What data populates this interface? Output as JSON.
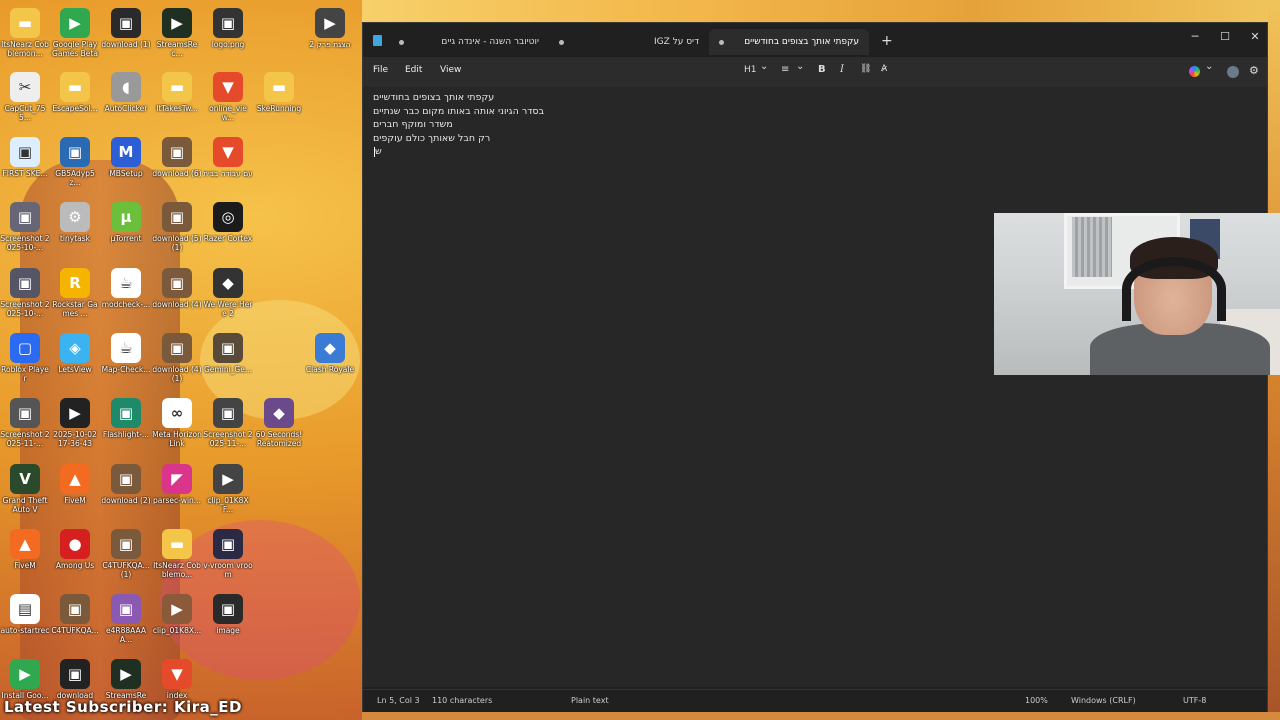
{
  "desktop": {
    "icons": [
      {
        "label": "ItsNearz Cobblemon...",
        "icon": "folder-icon",
        "color": "#f3c64a"
      },
      {
        "label": "Google Play Games Beta",
        "icon": "google-play-games-icon",
        "color": "#2fa84f"
      },
      {
        "label": "download (1)",
        "icon": "image-file-icon",
        "color": "#2a2a2a"
      },
      {
        "label": "StreamsRec...",
        "icon": "video-file-icon",
        "color": "#1f2f22"
      },
      {
        "label": "logo.png",
        "icon": "image-file-icon",
        "color": "#333"
      },
      {
        "label": "הצגת פרק 2",
        "icon": "video-file-icon",
        "color": "#444"
      },
      {
        "label": "CapCut_755...",
        "icon": "capcut-icon",
        "color": "#eeeeee"
      },
      {
        "label": "EscapeSol...",
        "icon": "folder-icon",
        "color": "#f3c64a"
      },
      {
        "label": "AutoClicker",
        "icon": "mouse-icon",
        "color": "#999"
      },
      {
        "label": "ItTakesTw...",
        "icon": "folder-icon",
        "color": "#f3c64a"
      },
      {
        "label": "online_view...",
        "icon": "brave-icon",
        "color": "#e54b2a"
      },
      {
        "label": "SkeRunning",
        "icon": "folder-icon",
        "color": "#f3c64a"
      },
      {
        "label": "FIRST SKE...",
        "icon": "image-file-icon",
        "color": "#ddeeff"
      },
      {
        "label": "GB5Adyp5z...",
        "icon": "image-file-icon",
        "color": "#2a6ab3"
      },
      {
        "label": "MBSetup",
        "icon": "malwarebytes-icon",
        "color": "#2c5fd6"
      },
      {
        "label": "download (6)",
        "icon": "image-file-icon",
        "color": "#7b5a3c"
      },
      {
        "label": "עם עבודה בבית",
        "icon": "brave-icon",
        "color": "#e54b2a"
      },
      {
        "label": "Screenshot 2025-10-...",
        "icon": "image-file-icon",
        "color": "#667"
      },
      {
        "label": "tinytask",
        "icon": "gear-icon",
        "color": "#bbb"
      },
      {
        "label": "μTorrent",
        "icon": "utorrent-icon",
        "color": "#6cbf3a"
      },
      {
        "label": "download (5) (1)",
        "icon": "image-file-icon",
        "color": "#7b5a3c"
      },
      {
        "label": "Razer Cortex",
        "icon": "razer-icon",
        "color": "#1b1b1b"
      },
      {
        "label": "Screenshot 2025-10-...",
        "icon": "image-file-icon",
        "color": "#556"
      },
      {
        "label": "Rockstar Games ...",
        "icon": "rockstar-icon",
        "color": "#f4b400"
      },
      {
        "label": "modcheck-...",
        "icon": "java-icon",
        "color": "#fff"
      },
      {
        "label": "download (4)",
        "icon": "image-file-icon",
        "color": "#7b5a3c"
      },
      {
        "label": "We Were Here 2",
        "icon": "game-icon",
        "color": "#333"
      },
      {
        "label": "Roblox Player",
        "icon": "roblox-icon",
        "color": "#2a6bf2"
      },
      {
        "label": "LetsView",
        "icon": "letsview-icon",
        "color": "#3bb3f0"
      },
      {
        "label": "Map-Check...",
        "icon": "java-icon",
        "color": "#fff"
      },
      {
        "label": "download (4) (1)",
        "icon": "image-file-icon",
        "color": "#7b5a3c"
      },
      {
        "label": "Gemini_Ge...",
        "icon": "image-file-icon",
        "color": "#5a4a3a"
      },
      {
        "label": "Clash Royale",
        "icon": "game-icon",
        "color": "#3a7bd5"
      },
      {
        "label": "Screenshot 2025-11-...",
        "icon": "image-file-icon",
        "color": "#555"
      },
      {
        "label": "2025-10-02 17-36-43",
        "icon": "video-file-icon",
        "color": "#222"
      },
      {
        "label": "Flashlight-...",
        "icon": "image-file-icon",
        "color": "#1e8a6a"
      },
      {
        "label": "Meta Horizon Link",
        "icon": "meta-icon",
        "color": "#ffffff"
      },
      {
        "label": "Screenshot 2025-11-...",
        "icon": "image-file-icon",
        "color": "#444"
      },
      {
        "label": "60 Seconds! Reatomized",
        "icon": "game-icon",
        "color": "#6a4a8a"
      },
      {
        "label": "Grand Theft Auto V",
        "icon": "gta-icon",
        "color": "#2b4a2b"
      },
      {
        "label": "FiveM",
        "icon": "fivem-icon",
        "color": "#f26b21"
      },
      {
        "label": "download (2)",
        "icon": "image-file-icon",
        "color": "#7b5a3c"
      },
      {
        "label": "parsec-win...",
        "icon": "parsec-icon",
        "color": "#d9358b"
      },
      {
        "label": "clip_01K8XF...",
        "icon": "video-file-icon",
        "color": "#444"
      },
      {
        "label": "FiveM",
        "icon": "fivem-icon",
        "color": "#f26b21"
      },
      {
        "label": "Among Us",
        "icon": "among-us-icon",
        "color": "#d61f1f"
      },
      {
        "label": "C4TUFKQA... (1)",
        "icon": "image-file-icon",
        "color": "#7b5a3c"
      },
      {
        "label": "ItsNearz Cobblemo...",
        "icon": "folder-icon",
        "color": "#f3c64a"
      },
      {
        "label": "v-vroom vroom",
        "icon": "image-file-icon",
        "color": "#2a2a44"
      },
      {
        "label": "auto-startrec",
        "icon": "text-file-icon",
        "color": "#ffffff"
      },
      {
        "label": "C4TUFKQA...",
        "icon": "image-file-icon",
        "color": "#7b5a3c"
      },
      {
        "label": "e4R88AAAA...",
        "icon": "image-file-icon",
        "color": "#8a5ab3"
      },
      {
        "label": "clip_01K8X...",
        "icon": "video-file-icon",
        "color": "#8a5a3a"
      },
      {
        "label": "image",
        "icon": "image-file-icon",
        "color": "#2a2a2a"
      },
      {
        "label": "Install Goo...",
        "icon": "google-play-games-icon",
        "color": "#2fa84f"
      },
      {
        "label": "download",
        "icon": "image-file-icon",
        "color": "#222"
      },
      {
        "label": "StreamsRec...",
        "icon": "video-file-icon",
        "color": "#1f2f22"
      },
      {
        "label": "index",
        "icon": "brave-icon",
        "color": "#e54b2a"
      }
    ],
    "subscriber_text": "Latest Subscriber: Kira_ED"
  },
  "notepad": {
    "tabs": [
      {
        "title": "יוטיובר השנה - אינדה גיים",
        "modified": true
      },
      {
        "title": "דיס על IGZ",
        "modified": true
      },
      {
        "title": "עקפתי אותך בצופים בחודשיים",
        "modified": true,
        "active": true
      }
    ],
    "new_tab_label": "+",
    "window_controls": {
      "minimize": "─",
      "maximize": "☐",
      "close": "✕"
    },
    "menu": {
      "file": "File",
      "edit": "Edit",
      "view": "View"
    },
    "toolbar": {
      "heading": "H1",
      "heading_chevron": "⌄",
      "list": "≡",
      "list_chevron": "⌄",
      "bold": "B",
      "italic": "I",
      "link": "⛓",
      "clear_format": "A̷"
    },
    "lines": [
      "עקפתי אותך בצופים בחודשיים",
      "בסדר הגיוני אותה באותו מקום כבר שנתיים",
      "משדר ומוקף חברים",
      "רק חבל שאותך כולם עוקפים",
      "ש"
    ],
    "status": {
      "position": "Ln 5, Col 3",
      "characters": "110 characters",
      "format": "Plain text",
      "zoom": "100%",
      "line_ending": "Windows (CRLF)",
      "encoding": "UTF-8"
    }
  },
  "colors": {
    "window_bg": "#202020",
    "editor_bg": "#272727",
    "accent": "#3fa7e0"
  }
}
